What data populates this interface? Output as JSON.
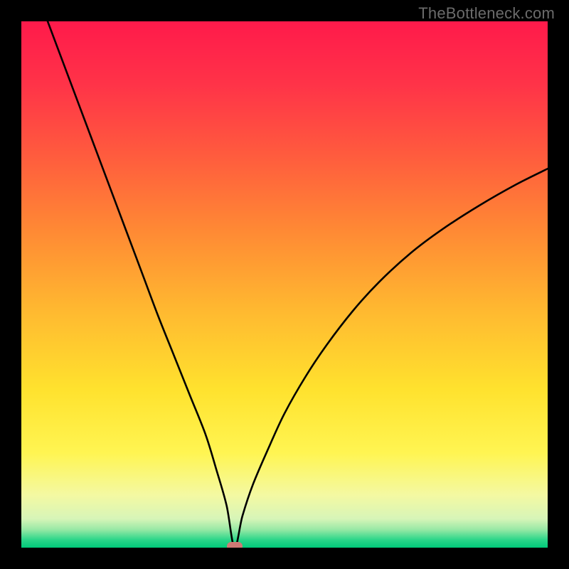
{
  "watermark": {
    "text": "TheBottleneck.com"
  },
  "colors": {
    "black": "#000000",
    "curve": "#000000",
    "pill": "#cf7a76",
    "watermark": "#6b6b6b"
  },
  "gradient_stops": [
    {
      "offset": 0.0,
      "color": "#ff1a4b"
    },
    {
      "offset": 0.12,
      "color": "#ff3348"
    },
    {
      "offset": 0.25,
      "color": "#ff5a3e"
    },
    {
      "offset": 0.4,
      "color": "#ff8a34"
    },
    {
      "offset": 0.55,
      "color": "#ffb930"
    },
    {
      "offset": 0.7,
      "color": "#ffe22e"
    },
    {
      "offset": 0.82,
      "color": "#fff552"
    },
    {
      "offset": 0.9,
      "color": "#f4f9a2"
    },
    {
      "offset": 0.945,
      "color": "#d7f5b8"
    },
    {
      "offset": 0.965,
      "color": "#9ae9a6"
    },
    {
      "offset": 0.985,
      "color": "#2bd689"
    },
    {
      "offset": 1.0,
      "color": "#00c97a"
    }
  ],
  "chart_data": {
    "type": "line",
    "title": "",
    "xlabel": "",
    "ylabel": "",
    "xlim": [
      0,
      100
    ],
    "ylim": [
      0,
      100
    ],
    "minimum_marker": {
      "x": 40.5,
      "y": 0
    },
    "series": [
      {
        "name": "bottleneck-curve",
        "x": [
          5,
          8,
          11,
          14,
          17,
          20,
          23,
          26,
          29,
          32,
          35,
          37,
          39,
          40.5,
          42,
          44,
          47,
          50,
          54,
          58,
          63,
          68,
          74,
          80,
          87,
          94,
          100
        ],
        "y": [
          100,
          92,
          84,
          76,
          68,
          60,
          52,
          44,
          36.5,
          29,
          21.5,
          15,
          8,
          0,
          6,
          12,
          19,
          25.5,
          32.5,
          38.5,
          45,
          50.5,
          56,
          60.5,
          65,
          69,
          72
        ]
      }
    ]
  }
}
